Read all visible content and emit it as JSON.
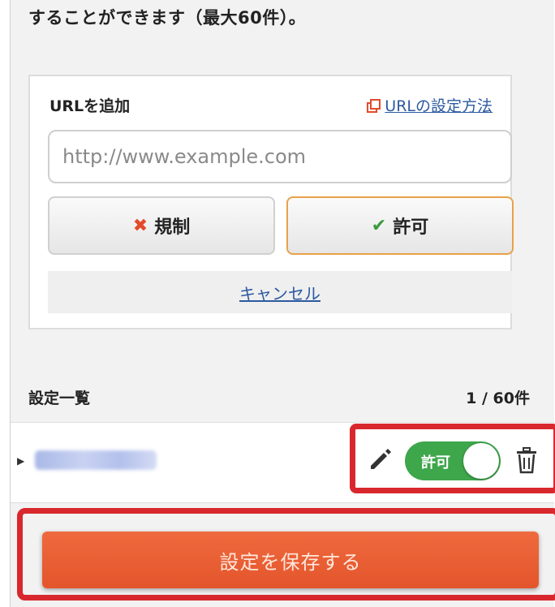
{
  "intro_text": "することができます（最大60件）。",
  "add_url": {
    "title": "URLを追加",
    "help_link": "URLの設定方法",
    "input_placeholder": "http://www.example.com",
    "input_value": "",
    "block_button": "規制",
    "allow_button": "許可",
    "block_mark": "✖",
    "allow_mark": "✔",
    "cancel_link": "キャンセル"
  },
  "settings_list": {
    "title": "設定一覧",
    "count": "1 / 60件",
    "rows": [
      {
        "url": "",
        "toggle_label": "許可",
        "toggle_state": "on"
      }
    ]
  },
  "save_button": "設定を保存する",
  "icons": [
    "external-link-icon",
    "x-mark-icon",
    "check-mark-icon",
    "caret-right-icon",
    "pencil-icon",
    "trash-icon"
  ],
  "colors": {
    "accent_orange": "#e4552c",
    "toggle_green": "#3ea64b",
    "highlight_red": "#d8282e",
    "link_blue": "#2c5aa0"
  }
}
